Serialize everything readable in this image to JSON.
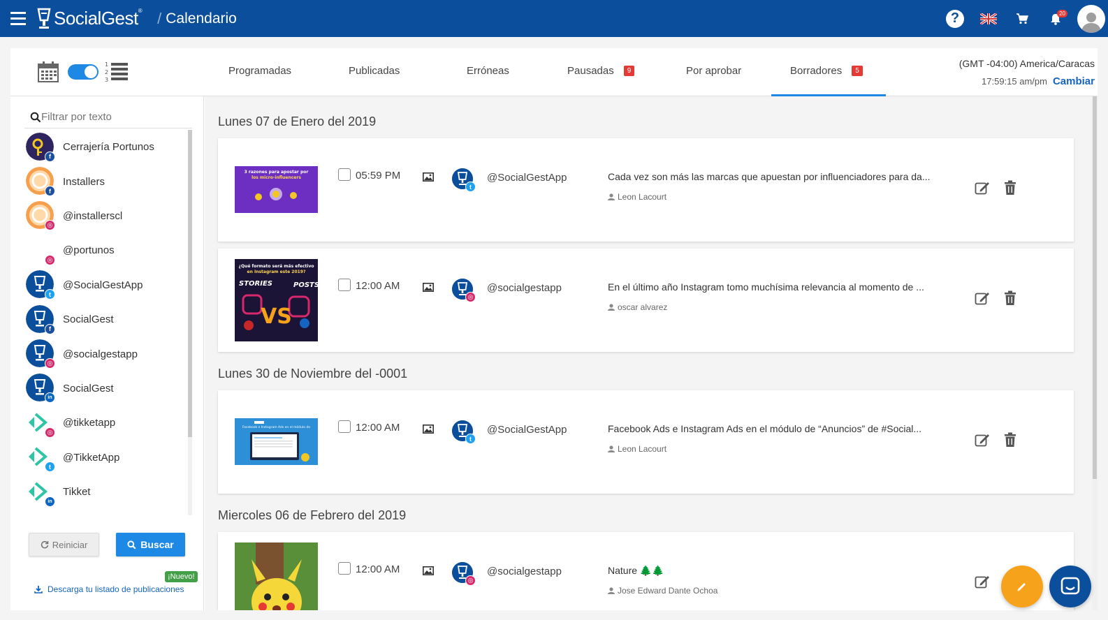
{
  "header": {
    "brand": "SocialGest",
    "brand_mark": "®",
    "separator": "/",
    "page_title": "Calendario",
    "notifications_count": "20",
    "icons": [
      "menu-icon",
      "help-icon",
      "uk-flag-icon",
      "cart-icon",
      "bell-icon",
      "user-avatar-icon"
    ]
  },
  "tabs": [
    {
      "label": "Programadas"
    },
    {
      "label": "Publicadas"
    },
    {
      "label": "Erróneas"
    },
    {
      "label": "Pausadas",
      "badge": "9"
    },
    {
      "label": "Por aprobar"
    },
    {
      "label": "Borradores",
      "badge": "5",
      "active": true
    }
  ],
  "timezone": {
    "label": "(GMT -04:00) America/Caracas",
    "time": "17:59:15 am/pm",
    "change_label": "Cambiar"
  },
  "sidebar": {
    "filter_placeholder": "Filtrar por texto",
    "accounts": [
      {
        "name": "Cerrajería Portunos",
        "network": "facebook"
      },
      {
        "name": "Installers",
        "network": "facebook"
      },
      {
        "name": "@installerscl",
        "network": "instagram"
      },
      {
        "name": "@portunos",
        "network": "instagram"
      },
      {
        "name": "@SocialGestApp",
        "network": "twitter"
      },
      {
        "name": "SocialGest",
        "network": "facebook"
      },
      {
        "name": "@socialgestapp",
        "network": "instagram"
      },
      {
        "name": "SocialGest",
        "network": "linkedin"
      },
      {
        "name": "@tikketapp",
        "network": "instagram"
      },
      {
        "name": "@TikketApp",
        "network": "twitter"
      },
      {
        "name": "Tikket",
        "network": "linkedin"
      }
    ],
    "reset_label": "Reiniciar",
    "search_label": "Buscar",
    "new_badge": "¡Nuevo!",
    "download_label": "Descarga tu listado de publicaciones"
  },
  "groups": [
    {
      "date": "Lunes 07 de Enero del 2019",
      "posts": [
        {
          "time": "05:59 PM",
          "handle": "@SocialGestApp",
          "network": "twitter",
          "message": "Cada vez son más las marcas que apuestan por influenciadores para da...",
          "author": "Leon Lacourt",
          "thumb_text": "3 razones para apostar por los micro-influencers"
        },
        {
          "time": "12:00 AM",
          "handle": "@socialgestapp",
          "network": "instagram",
          "message": "En el último año Instagram tomo muchísima relevancia al momento de ...",
          "author": "oscar alvarez",
          "thumb_text": "STORIES VS POSTS"
        }
      ]
    },
    {
      "date": "Lunes 30 de Noviembre del -0001",
      "posts": [
        {
          "time": "12:00 AM",
          "handle": "@SocialGestApp",
          "network": "twitter",
          "message": "Facebook Ads e Instagram Ads en el módulo de “Anuncios” de #Social...",
          "author": "Leon Lacourt",
          "thumb_text": "Facebook e Instagram Ads"
        }
      ]
    },
    {
      "date": "Miercoles 06 de Febrero del 2019",
      "posts": [
        {
          "time": "12:00 AM",
          "handle": "@socialgestapp",
          "network": "instagram",
          "message": "Nature 🌲🌲",
          "author": "Jose Edward Dante Ochoa",
          "thumb_text": "Pikachu"
        }
      ]
    }
  ],
  "colors": {
    "brand_blue": "#0b4f9c",
    "accent_blue": "#1e88e5",
    "badge_red": "#e53935",
    "fab_orange": "#f7a21b",
    "new_green": "#43a047"
  }
}
